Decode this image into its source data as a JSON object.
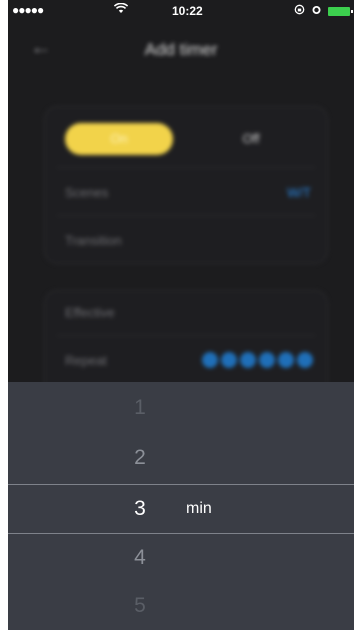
{
  "status_bar": {
    "signal": "●●●●●",
    "wifi_icon": "wifi-icon",
    "time": "10:22",
    "right_icons": [
      "rotation-lock-icon",
      "alarm-icon",
      "battery-icon"
    ]
  },
  "nav": {
    "back_icon": "back-arrow-icon",
    "title": "Add timer"
  },
  "power": {
    "on_label": "On",
    "off_label": "Off",
    "selected": "On"
  },
  "settings": {
    "scenes_label": "Scenes",
    "scenes_value": "W/T",
    "transition_label": "Transition",
    "effective_label": "Effective",
    "repeat_label": "Repeat"
  },
  "picker": {
    "numbers": [
      "1",
      "2",
      "3",
      "4",
      "5"
    ],
    "selected": "3",
    "unit": "min"
  },
  "colors": {
    "accent_yellow": "#f2d34a",
    "accent_blue": "#2a8be8",
    "picker_bg": "#3a3d45"
  }
}
